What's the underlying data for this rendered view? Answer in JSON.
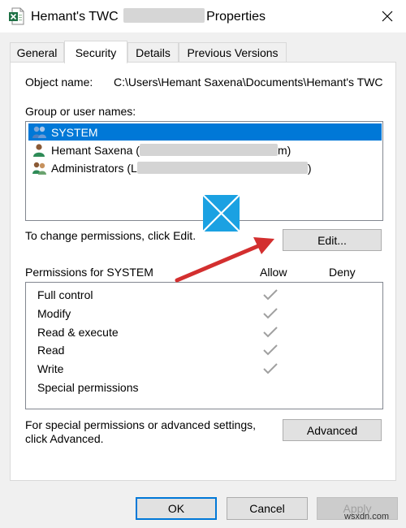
{
  "window": {
    "title_prefix": "Hemant's TWC",
    "title_suffix": "Properties",
    "close_glyph": "✕",
    "app_icon": "excel-file-icon"
  },
  "tabs": [
    {
      "label": "General",
      "active": false
    },
    {
      "label": "Security",
      "active": true
    },
    {
      "label": "Details",
      "active": false
    },
    {
      "label": "Previous Versions",
      "active": false
    }
  ],
  "security": {
    "object_name_label": "Object name:",
    "object_name_value": "C:\\Users\\Hemant Saxena\\Documents\\Hemant's TWC",
    "group_label": "Group or user names:",
    "groups": [
      {
        "name": "SYSTEM",
        "suffix": "",
        "icon": "group-users-icon",
        "selected": true
      },
      {
        "name": "Hemant Saxena (",
        "suffix": "m)",
        "icon": "single-user-icon",
        "selected": false
      },
      {
        "name": "Administrators (L",
        "suffix": ")",
        "icon": "group-users-icon",
        "selected": false
      }
    ],
    "change_text": "To change permissions, click Edit.",
    "edit_label": "Edit...",
    "permissions_for": "Permissions for SYSTEM",
    "allow_label": "Allow",
    "deny_label": "Deny",
    "permissions": [
      {
        "name": "Full control",
        "allow": true,
        "deny": false
      },
      {
        "name": "Modify",
        "allow": true,
        "deny": false
      },
      {
        "name": "Read & execute",
        "allow": true,
        "deny": false
      },
      {
        "name": "Read",
        "allow": true,
        "deny": false
      },
      {
        "name": "Write",
        "allow": true,
        "deny": false
      },
      {
        "name": "Special permissions",
        "allow": false,
        "deny": false
      }
    ],
    "advanced_text_line1": "For special permissions or advanced settings,",
    "advanced_text_line2": "click Advanced.",
    "advanced_label": "Advanced"
  },
  "footer": {
    "ok_label": "OK",
    "cancel_label": "Cancel",
    "apply_label": "Apply"
  },
  "watermark": "wsxdn.com",
  "colors": {
    "selection": "#0078d7",
    "arrow": "#d32f2f",
    "check": "#a0a0a0",
    "logo": "#1ba1e2"
  }
}
